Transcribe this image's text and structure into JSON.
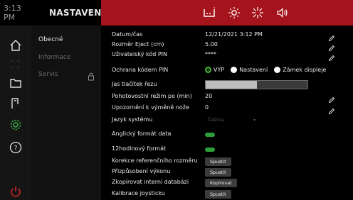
{
  "header": {
    "time": "3:13 PM",
    "title": "NASTAVENÍ",
    "icons": [
      "printer-status-icon",
      "brightness-icon",
      "lamp-icon",
      "sound-icon"
    ],
    "accent": "#a5131c"
  },
  "sidebar": {
    "icons": [
      "home-icon",
      "grid-icon",
      "folder-icon",
      "cutter-icon",
      "settings-icon",
      "help-icon",
      "power-icon"
    ]
  },
  "menu": {
    "items": [
      {
        "label": "Obecné",
        "state": "active"
      },
      {
        "label": "Informace",
        "state": "dim"
      },
      {
        "label": "Servis",
        "state": "dim"
      }
    ]
  },
  "settings": {
    "datetime": {
      "label": "Datum/čas",
      "value": "12/21/2021 3:12 PM"
    },
    "eject": {
      "label": "Rozměr Eject (cm)",
      "value": "5.00"
    },
    "pin": {
      "label": "Uživatelský kód PIN",
      "value": "****"
    },
    "pin_protect": {
      "label": "Ochrana kódem PIN",
      "options": [
        "VYP",
        "Nastavení",
        "Zámek displeje"
      ],
      "selected": "VYP"
    },
    "brightness": {
      "label": "Jas tlačítek řezu",
      "level": 0.5
    },
    "standby": {
      "label": "Pohotovostní režim po (min)",
      "value": "20"
    },
    "blade_warning": {
      "label": "Upozornění k výměně nože",
      "value": "0"
    },
    "language": {
      "label": "Jazyk systému",
      "value": "Čeština"
    },
    "eng_date": {
      "label": "Anglický formát data",
      "enabled": true
    },
    "clock12": {
      "label": "12hodinový formát",
      "enabled": true
    },
    "ref_correction": {
      "label": "Korekce referenčního rozměru",
      "button": "Spustit"
    },
    "performance": {
      "label": "Přizpůsobení výkonu",
      "button": "Spustit"
    },
    "db_copy": {
      "label": "Zkopírovat interní databázi",
      "button": "Kopírovat"
    },
    "joystick": {
      "label": "Kalibrace joysticku",
      "button": "Spustit"
    }
  },
  "colors": {
    "toggle_on": "#2c9e3a",
    "radio_selected": "#48b93c"
  }
}
